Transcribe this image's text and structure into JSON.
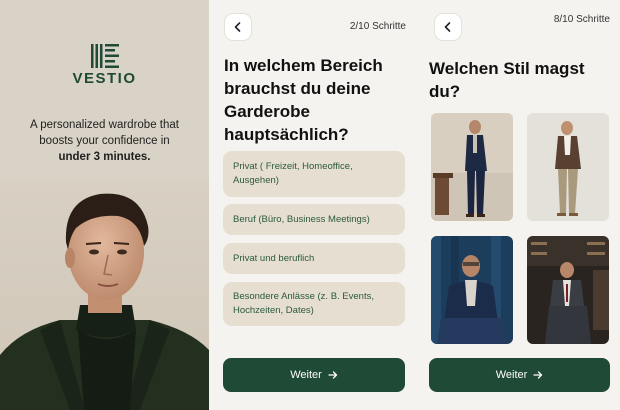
{
  "screen1": {
    "logo_text": "VESTIO",
    "tagline": "A personalized wardrobe that boosts your confidence in",
    "tagline_bold": "under 3 minutes."
  },
  "screen2": {
    "step": "2/10 Schritte",
    "question": "In welchem Bereich brauchst du deine Garderobe hauptsächlich?",
    "options": [
      "Privat ( Freizeit, Homeoffice, Ausgehen)",
      "Beruf (Büro, Business Meetings)",
      "Privat und beruflich",
      "Besondere Anlässe (z. B. Events, Hochzeiten, Dates)"
    ],
    "cta": "Weiter"
  },
  "screen3": {
    "step": "8/10 Schritte",
    "question": "Welchen Stil magst du?",
    "cta": "Weiter"
  },
  "colors": {
    "brand_green": "#1f4a35",
    "beige": "#d9d2c6",
    "option_bg": "#e6ded0"
  },
  "icons": {
    "back": "chevron-left-icon",
    "next": "arrow-right-icon",
    "logo": "vestio-logo-icon"
  }
}
